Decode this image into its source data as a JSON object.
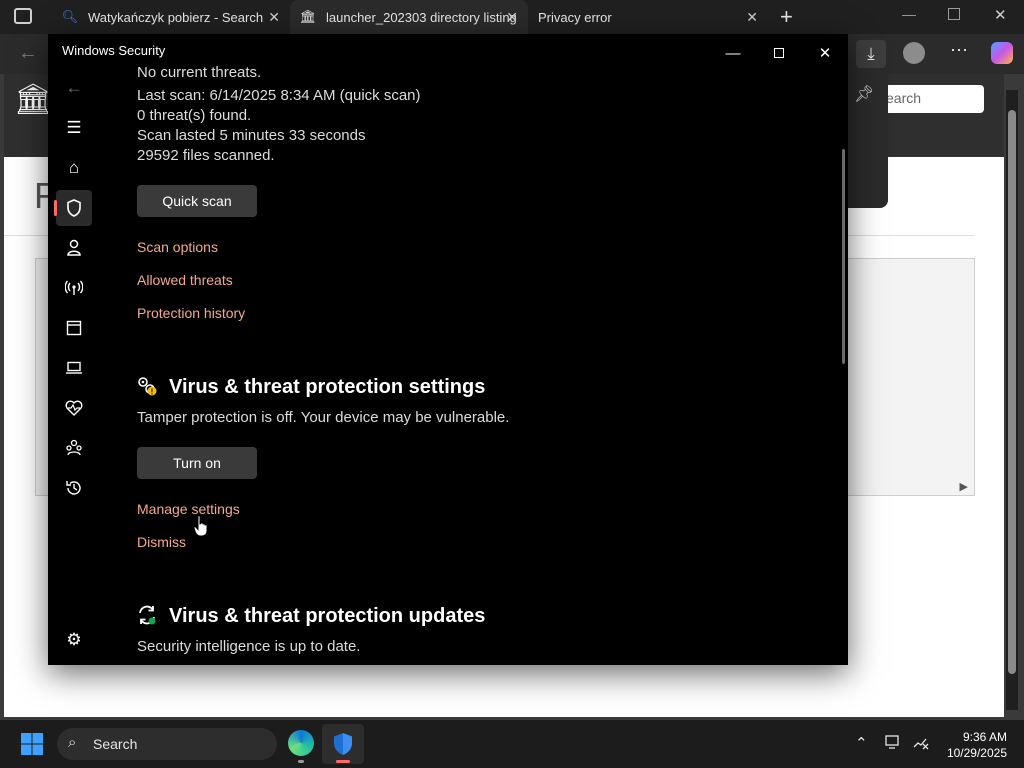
{
  "browser": {
    "tabs": [
      {
        "label": "Watykańczyk pobierz - Search",
        "icon": "search-icon"
      },
      {
        "label": "launcher_202303 directory listing",
        "icon": "archive-icon"
      },
      {
        "label": "Privacy error",
        "icon": ""
      }
    ],
    "page_search_placeholder": "earch",
    "page_heading_fragment": "F"
  },
  "window": {
    "title": "Windows Security"
  },
  "scan": {
    "status": "No current threats.",
    "last_scan": "Last scan: 6/14/2025 8:34 AM (quick scan)",
    "threats_found": "0 threat(s) found.",
    "duration": "Scan lasted 5 minutes 33 seconds",
    "files_scanned": "29592 files scanned.",
    "quick_scan_label": "Quick scan",
    "links": [
      "Scan options",
      "Allowed threats",
      "Protection history"
    ]
  },
  "settings": {
    "heading": "Virus & threat protection settings",
    "warning": "Tamper protection is off. Your device may be vulnerable.",
    "turn_on_label": "Turn on",
    "manage_label": "Manage settings",
    "dismiss_label": "Dismiss"
  },
  "updates": {
    "heading": "Virus & threat protection updates",
    "status": "Security intelligence is up to date."
  },
  "taskbar": {
    "search_label": "Search",
    "time": "9:36 AM",
    "date": "10/29/2025"
  },
  "colors": {
    "link": "#f4a98c",
    "accent_selected": "#ff6b6b"
  }
}
